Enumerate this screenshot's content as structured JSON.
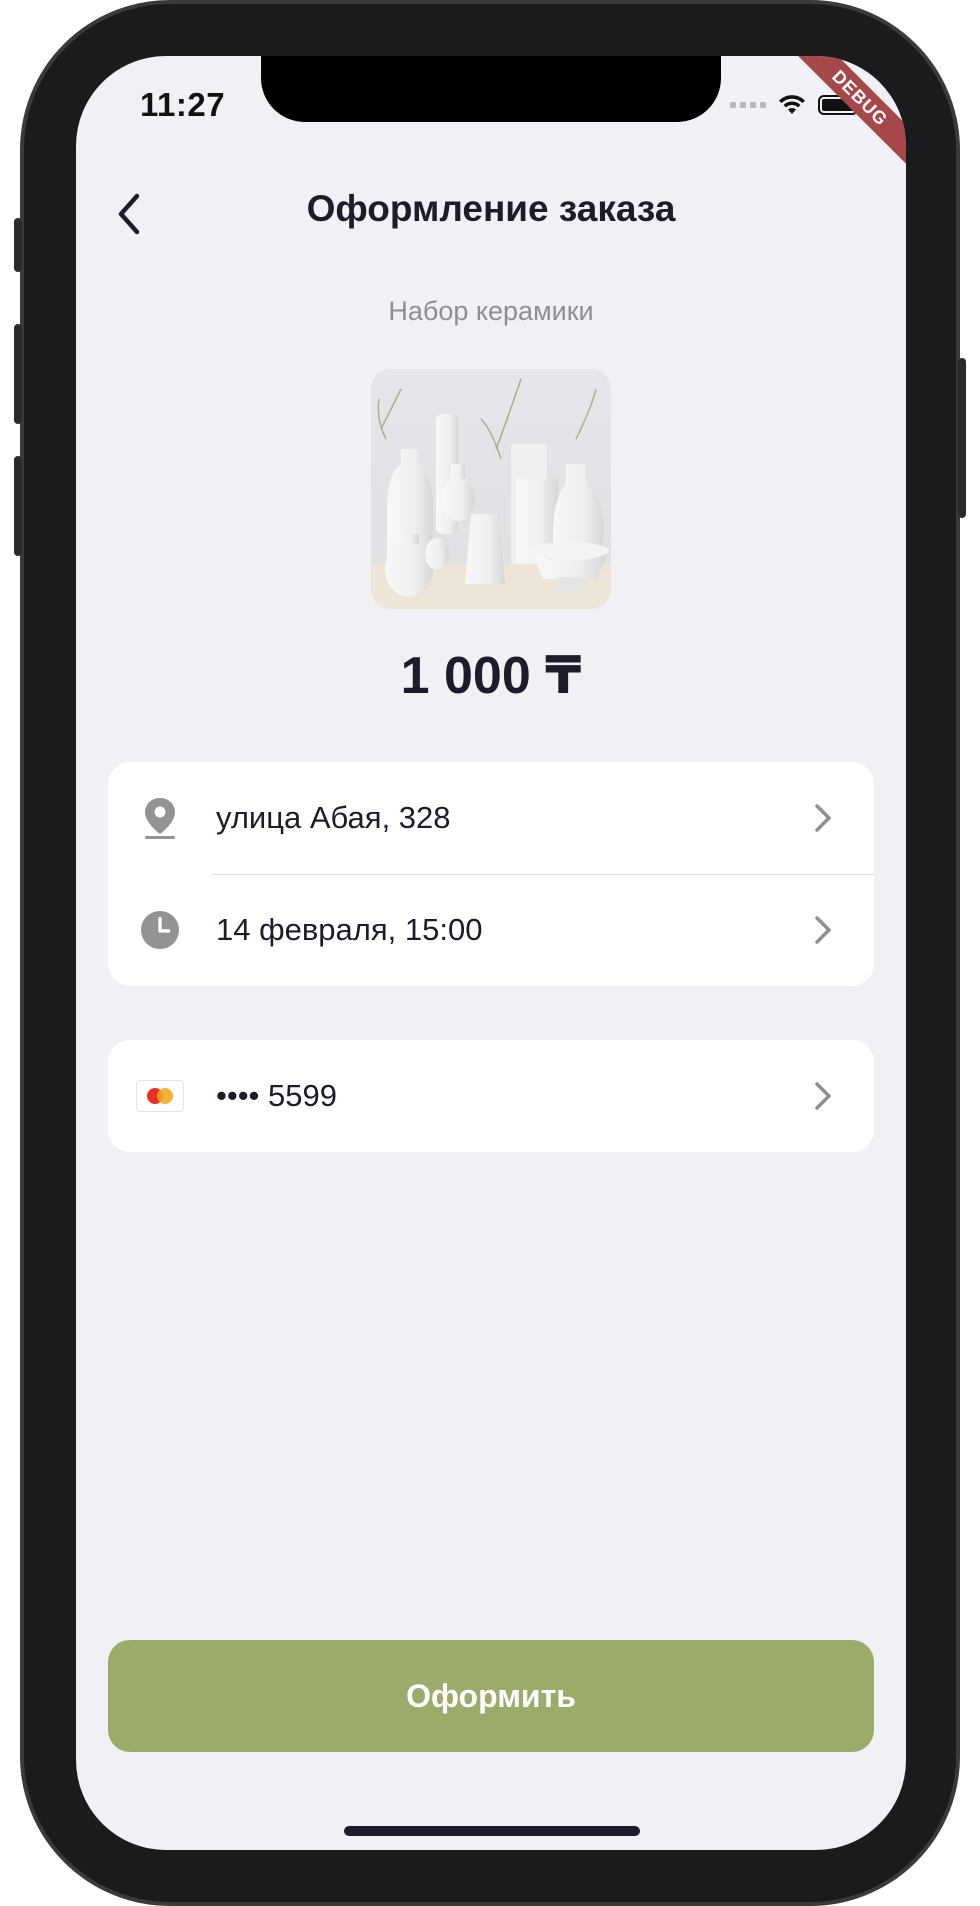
{
  "status_bar": {
    "time": "11:27",
    "debug_badge": "DEBUG"
  },
  "header": {
    "title": "Оформление заказа",
    "back_icon": "chevron-left-icon"
  },
  "product": {
    "name": "Набор керамики",
    "image": "white ceramic vases set",
    "price": "1 000 ₸"
  },
  "delivery": {
    "address": "улица Абая, 328",
    "address_icon": "location-pin-icon",
    "datetime": "14 февраля, 15:00",
    "datetime_icon": "clock-icon"
  },
  "payment": {
    "card_masked": "•••• 5599",
    "card_icon": "mastercard-icon"
  },
  "actions": {
    "submit_label": "Оформить"
  },
  "colors": {
    "background": "#f0f0f5",
    "accent": "#9bab6a",
    "text_primary": "#1d1c2b",
    "text_secondary": "#8e8e93"
  }
}
